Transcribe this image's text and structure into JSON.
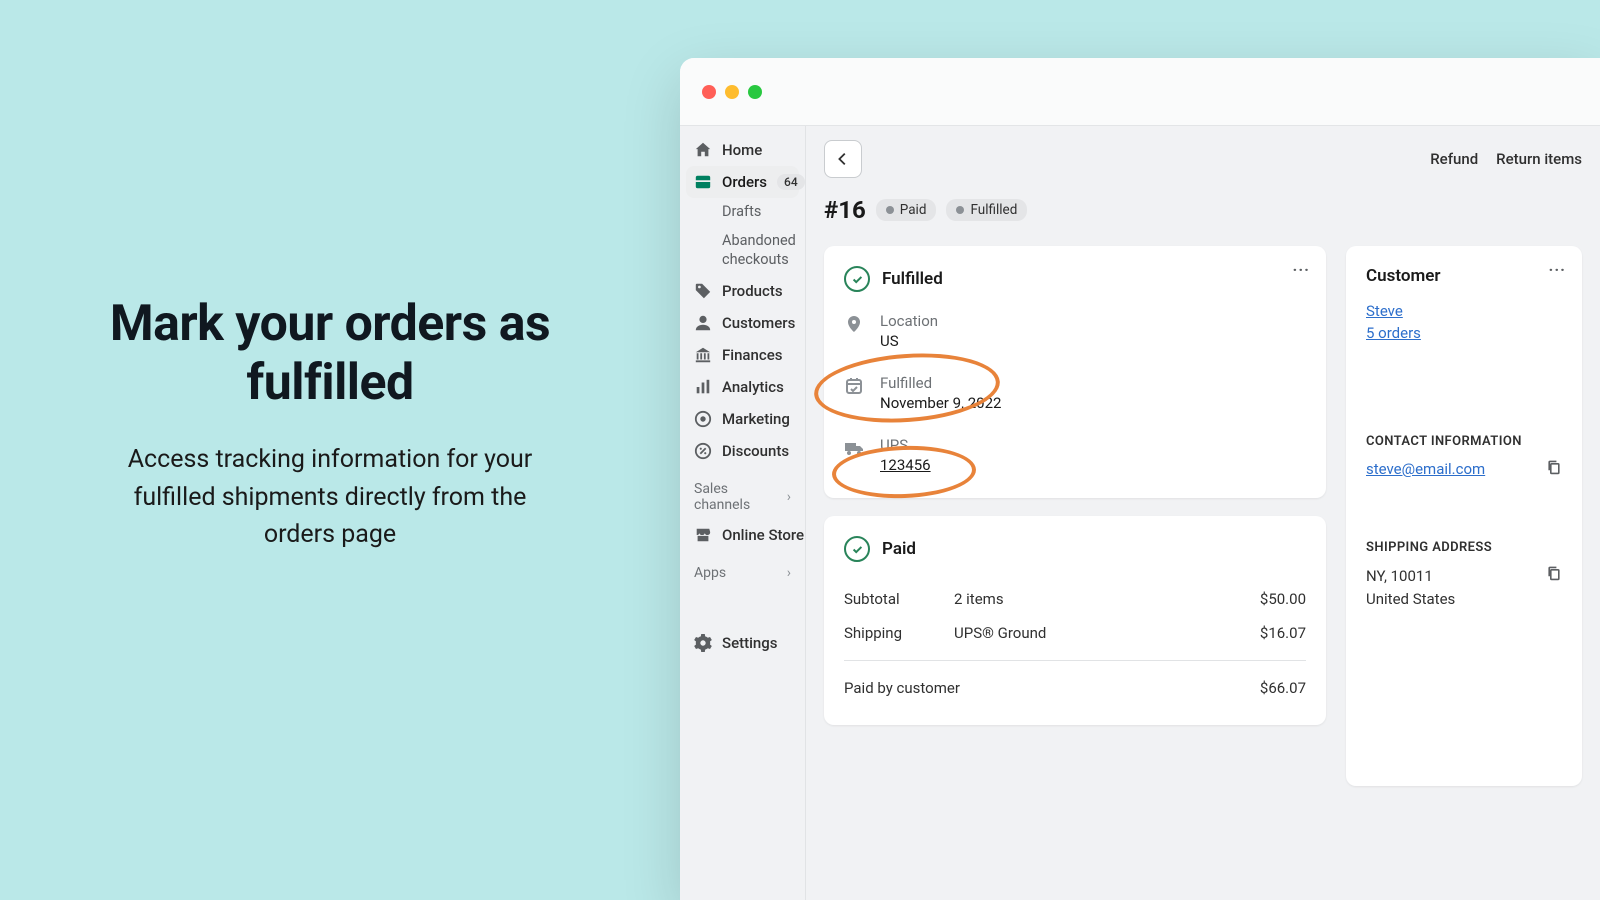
{
  "marketing": {
    "headline": "Mark your orders as fulfilled",
    "subtext": "Access tracking information for your fulfilled shipments directly from the orders page"
  },
  "sidebar": {
    "items": [
      {
        "label": "Home"
      },
      {
        "label": "Orders",
        "badge": "64"
      },
      {
        "label": "Products"
      },
      {
        "label": "Customers"
      },
      {
        "label": "Finances"
      },
      {
        "label": "Analytics"
      },
      {
        "label": "Marketing"
      },
      {
        "label": "Discounts"
      }
    ],
    "orderSubs": [
      "Drafts",
      "Abandoned checkouts"
    ],
    "salesChannelsHeader": "Sales channels",
    "onlineStore": "Online Store",
    "appsHeader": "Apps",
    "settings": "Settings"
  },
  "top": {
    "refund": "Refund",
    "returnItems": "Return items"
  },
  "order": {
    "number": "#16",
    "badges": [
      "Paid",
      "Fulfilled"
    ]
  },
  "fulfilled": {
    "title": "Fulfilled",
    "locationLabel": "Location",
    "locationValue": "US",
    "fulfilledLabel": "Fulfilled",
    "fulfilledDate": "November 9, 2022",
    "carrier": "UPS",
    "tracking": "123456"
  },
  "paid": {
    "title": "Paid",
    "subtotalLabel": "Subtotal",
    "subtotalDesc": "2 items",
    "subtotalAmount": "$50.00",
    "shippingLabel": "Shipping",
    "shippingDesc": "UPS® Ground",
    "shippingAmount": "$16.07",
    "paidByCustomer": "Paid by customer",
    "totalAmount": "$66.07"
  },
  "customer": {
    "title": "Customer",
    "name": "Steve",
    "ordersCount": "5 orders",
    "contactHeader": "CONTACT INFORMATION",
    "email": "steve@email.com",
    "shippingHeader": "SHIPPING ADDRESS",
    "address1": "NY, 10011",
    "address2": "United States"
  }
}
